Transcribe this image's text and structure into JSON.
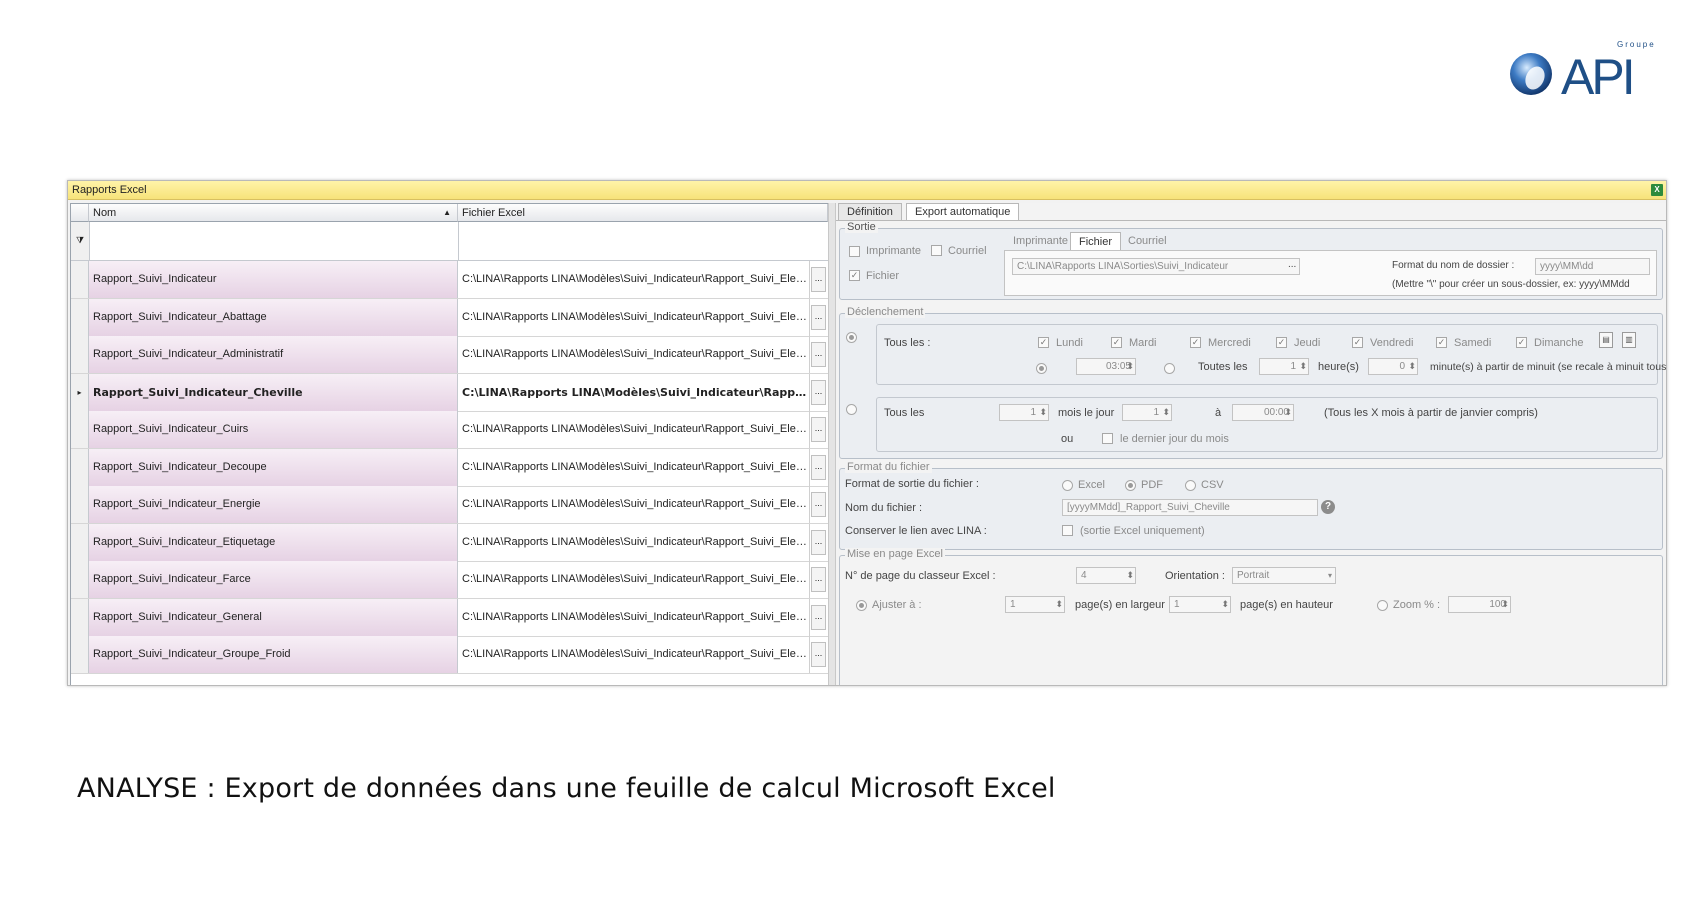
{
  "brand": {
    "group": "Groupe",
    "name": "API",
    "colors": {
      "logo_blue": "#1f4f86",
      "logo_light": "#6fa7d8"
    }
  },
  "caption": "ANALYSE : Export de données dans une feuille de calcul Microsoft Excel",
  "window": {
    "title": "Rapports Excel",
    "icon": "excel-icon"
  },
  "grid": {
    "columns": [
      {
        "label": "Nom",
        "sort": "ascending"
      },
      {
        "label": "Fichier Excel"
      }
    ],
    "filter_icon": "filter-icon",
    "rows": [
      {
        "name": "Rapport_Suivi_Indicateur",
        "file": "C:\\LINA\\Rapports LINA\\Modèles\\Suivi_Indicateur\\Rapport_Suivi_Electri...",
        "current": false
      },
      {
        "name": "Rapport_Suivi_Indicateur_Abattage",
        "file": "C:\\LINA\\Rapports LINA\\Modèles\\Suivi_Indicateur\\Rapport_Suivi_Electri...",
        "current": false
      },
      {
        "name": "Rapport_Suivi_Indicateur_Administratif",
        "file": "C:\\LINA\\Rapports LINA\\Modèles\\Suivi_Indicateur\\Rapport_Suivi_Electri...",
        "current": false
      },
      {
        "name": "Rapport_Suivi_Indicateur_Cheville",
        "file": "C:\\LINA\\Rapports LINA\\Modèles\\Suivi_Indicateur\\Rapport_...",
        "current": true
      },
      {
        "name": "Rapport_Suivi_Indicateur_Cuirs",
        "file": "C:\\LINA\\Rapports LINA\\Modèles\\Suivi_Indicateur\\Rapport_Suivi_Electri...",
        "current": false
      },
      {
        "name": "Rapport_Suivi_Indicateur_Decoupe",
        "file": "C:\\LINA\\Rapports LINA\\Modèles\\Suivi_Indicateur\\Rapport_Suivi_Electri...",
        "current": false
      },
      {
        "name": "Rapport_Suivi_Indicateur_Energie",
        "file": "C:\\LINA\\Rapports LINA\\Modèles\\Suivi_Indicateur\\Rapport_Suivi_Electri...",
        "current": false
      },
      {
        "name": "Rapport_Suivi_Indicateur_Etiquetage",
        "file": "C:\\LINA\\Rapports LINA\\Modèles\\Suivi_Indicateur\\Rapport_Suivi_Electri...",
        "current": false
      },
      {
        "name": "Rapport_Suivi_Indicateur_Farce",
        "file": "C:\\LINA\\Rapports LINA\\Modèles\\Suivi_Indicateur\\Rapport_Suivi_Electri...",
        "current": false
      },
      {
        "name": "Rapport_Suivi_Indicateur_General",
        "file": "C:\\LINA\\Rapports LINA\\Modèles\\Suivi_Indicateur\\Rapport_Suivi_Electri...",
        "current": false
      },
      {
        "name": "Rapport_Suivi_Indicateur_Groupe_Froid",
        "file": "C:\\LINA\\Rapports LINA\\Modèles\\Suivi_Indicateur\\Rapport_Suivi_Electri...",
        "current": false
      }
    ],
    "ellipsis_label": "..."
  },
  "panel": {
    "tabs": [
      {
        "label": "Définition",
        "active": false
      },
      {
        "label": "Export automatique",
        "active": true
      }
    ],
    "sortie": {
      "title": "Sortie",
      "imprimante": {
        "label": "Imprimante",
        "checked": false
      },
      "courriel": {
        "label": "Courriel",
        "checked": false
      },
      "fichier": {
        "label": "Fichier",
        "checked": true
      },
      "subtabs": [
        {
          "label": "Imprimante",
          "active": false
        },
        {
          "label": "Fichier",
          "active": true
        },
        {
          "label": "Courriel",
          "active": false
        }
      ],
      "path_value": "C:\\LINA\\Rapports LINA\\Sorties\\Suivi_Indicateur",
      "browse_label": "...",
      "folder_format_label": "Format du nom de dossier :",
      "folder_format_value": "yyyy\\MM\\dd",
      "folder_hint": "(Mettre \"\\\" pour créer un sous-dossier, ex: yyyy\\MMdd"
    },
    "declenchement": {
      "title": "Déclenchement",
      "weekly": {
        "tous_les": "Tous les :",
        "days": [
          {
            "label": "Lundi",
            "checked": true
          },
          {
            "label": "Mardi",
            "checked": true
          },
          {
            "label": "Mercredi",
            "checked": true
          },
          {
            "label": "Jeudi",
            "checked": true
          },
          {
            "label": "Vendredi",
            "checked": true
          },
          {
            "label": "Samedi",
            "checked": true
          },
          {
            "label": "Dimanche",
            "checked": true
          }
        ],
        "time_value": "03:05",
        "toutes_les": "Toutes les",
        "heures_value": "1",
        "heures_label": "heure(s)",
        "minutes_value": "0",
        "minutes_label": "minute(s) à partir de minuit (se recale à minuit tous les jours"
      },
      "monthly": {
        "tous_les": "Tous les",
        "mois_value": "1",
        "mois_label": "mois le jour",
        "jour_value": "1",
        "a_label": "à",
        "time_value": "00:00",
        "hint": "(Tous les X mois à partir de janvier compris)",
        "ou_label": "ou",
        "last_day_label": "le dernier jour du mois"
      }
    },
    "format": {
      "title": "Format du fichier",
      "sortie_label": "Format de sortie du fichier :",
      "options": [
        {
          "label": "Excel",
          "selected": false
        },
        {
          "label": "PDF",
          "selected": true
        },
        {
          "label": "CSV",
          "selected": false
        }
      ],
      "nom_label": "Nom du fichier :",
      "nom_value": "[yyyyMMdd]_Rapport_Suivi_Cheville",
      "help_label": "?",
      "lien_label": "Conserver le lien avec LINA :",
      "lien_hint": "(sortie Excel uniquement)"
    },
    "mise_en_page": {
      "title": "Mise en page Excel",
      "page_label": "N° de page du classeur Excel :",
      "page_value": "4",
      "orientation_label": "Orientation :",
      "orientation_value": "Portrait",
      "ajuster_label": "Ajuster à :",
      "largeur_value": "1",
      "largeur_label": "page(s) en largeur",
      "hauteur_value": "1",
      "hauteur_label": "page(s) en hauteur",
      "zoom_label": "Zoom % :",
      "zoom_value": "100"
    }
  }
}
